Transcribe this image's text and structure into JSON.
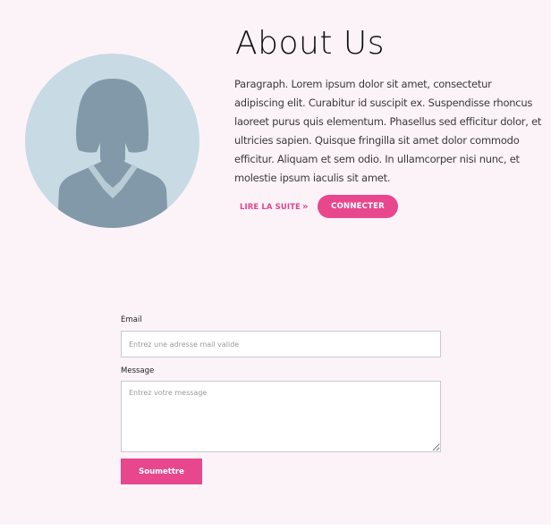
{
  "about": {
    "title": "About Us",
    "paragraph": "Paragraph. Lorem ipsum dolor sit amet, consectetur adipiscing elit. Curabitur id suscipit ex. Suspendisse rhoncus laoreet purus quis elementum. Phasellus sed efficitur dolor, et ultricies sapien. Quisque fringilla sit amet dolor commodo efficitur. Aliquam et sem odio. In ullamcorper nisi nunc, et molestie ipsum iaculis sit amet.",
    "read_more_label": "LIRE LA SUITE",
    "read_more_icon": "double-chevron-right-icon",
    "connect_label": "CONNECTER",
    "avatar_icon": "female-user-silhouette-icon"
  },
  "form": {
    "email_label": "Email",
    "email_placeholder": "Entrez une adresse mail valide",
    "email_value": "",
    "message_label": "Message",
    "message_placeholder": "Entrez votre message",
    "message_value": "",
    "submit_label": "Soumettre"
  },
  "colors": {
    "accent": "#e8478e",
    "page_background": "#fcf3f9",
    "avatar_background": "#c8dae3",
    "avatar_silhouette": "#8299a9"
  }
}
